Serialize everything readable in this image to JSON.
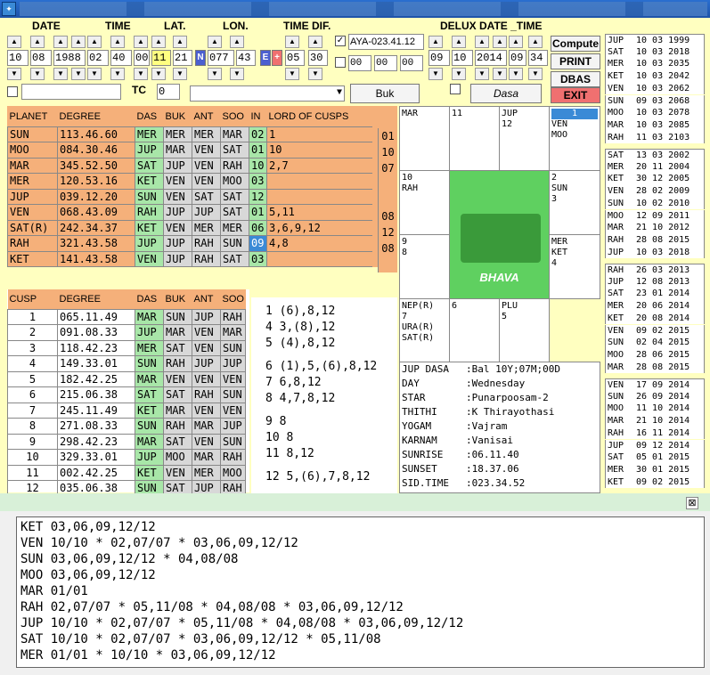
{
  "headers": {
    "date": "DATE",
    "time": "TIME",
    "lat": "LAT.",
    "lon": "LON.",
    "timedif": "TIME DIF.",
    "delux": "DELUX DATE _TIME"
  },
  "inputs": {
    "day": "10",
    "month": "08",
    "year": "1988",
    "hour": "02",
    "min": "40",
    "sec": "00",
    "lat_d": "11",
    "lat_m": "21",
    "lat_dir": "N",
    "lon_d": "077",
    "lon_m": "43",
    "lon_dir": "E",
    "tz_sign": "+",
    "tz_h": "05",
    "tz_m": "30",
    "ayanamsa": "AYA-023.41.12",
    "aya2": [
      "00",
      "00",
      "00"
    ],
    "dx_day": "09",
    "dx_month": "10",
    "dx_year": "2014",
    "dx_hour": "09",
    "dx_min": "34",
    "tc_label": "TC",
    "tc_value": "0"
  },
  "buttons": {
    "compute": "Compute",
    "print": "PRINT",
    "dbas": "DBAS",
    "exit": "EXIT",
    "buk": "Buk",
    "dasa": "Dasa"
  },
  "planet_table": {
    "headers": [
      "PLANET",
      "DEGREE",
      "DAS",
      "BUK",
      "ANT",
      "SOO",
      "IN",
      "LORD OF CUSPS"
    ],
    "rows": [
      [
        "SUN",
        "113.46.60",
        "MER",
        "MER",
        "MER",
        "MAR",
        "02",
        "1"
      ],
      [
        "MOO",
        "084.30.46",
        "JUP",
        "MAR",
        "VEN",
        "SAT",
        "01",
        "10"
      ],
      [
        "MAR",
        "345.52.50",
        "SAT",
        "JUP",
        "VEN",
        "RAH",
        "10",
        "2,7"
      ],
      [
        "MER",
        "120.53.16",
        "KET",
        "VEN",
        "VEN",
        "MOO",
        "03",
        ""
      ],
      [
        "JUP",
        "039.12.20",
        "SUN",
        "VEN",
        "SAT",
        "SAT",
        "12",
        ""
      ],
      [
        "VEN",
        "068.43.09",
        "RAH",
        "JUP",
        "JUP",
        "SAT",
        "01",
        "5,11"
      ],
      [
        "SAT(R)",
        "242.34.37",
        "KET",
        "VEN",
        "MER",
        "MER",
        "06",
        "3,6,9,12"
      ],
      [
        "RAH",
        "321.43.58",
        "JUP",
        "JUP",
        "RAH",
        "SUN",
        "09",
        "4,8"
      ],
      [
        "KET",
        "141.43.58",
        "VEN",
        "JUP",
        "RAH",
        "SAT",
        "03",
        ""
      ]
    ],
    "side": [
      "01",
      "10",
      "07",
      "",
      "",
      "08",
      "12",
      "08",
      ""
    ]
  },
  "cusp_table": {
    "headers": [
      "CUSP",
      "DEGREE",
      "DAS",
      "BUK",
      "ANT",
      "SOO"
    ],
    "rows": [
      [
        "1",
        "065.11.49",
        "MAR",
        "SUN",
        "JUP",
        "RAH"
      ],
      [
        "2",
        "091.08.33",
        "JUP",
        "MAR",
        "VEN",
        "MAR"
      ],
      [
        "3",
        "118.42.23",
        "MER",
        "SAT",
        "VEN",
        "SUN"
      ],
      [
        "4",
        "149.33.01",
        "SUN",
        "RAH",
        "JUP",
        "JUP"
      ],
      [
        "5",
        "182.42.25",
        "MAR",
        "VEN",
        "VEN",
        "VEN"
      ],
      [
        "6",
        "215.06.38",
        "SAT",
        "SAT",
        "RAH",
        "SUN"
      ],
      [
        "7",
        "245.11.49",
        "KET",
        "MAR",
        "VEN",
        "VEN"
      ],
      [
        "8",
        "271.08.33",
        "SUN",
        "RAH",
        "MAR",
        "JUP"
      ],
      [
        "9",
        "298.42.23",
        "MAR",
        "SAT",
        "VEN",
        "SUN"
      ],
      [
        "10",
        "329.33.01",
        "JUP",
        "MOO",
        "MAR",
        "RAH"
      ],
      [
        "11",
        "002.42.25",
        "KET",
        "VEN",
        "MER",
        "MOO"
      ],
      [
        "12",
        "035.06.38",
        "SUN",
        "SAT",
        "JUP",
        "RAH"
      ]
    ]
  },
  "significators": [
    [
      "1  (6),8,12",
      "4  3,(8),12",
      "5  (4),8,12"
    ],
    [
      "6  (1),5,(6),8,12",
      "7  6,8,12",
      "8  4,7,8,12"
    ],
    [
      "9  8",
      "10  8",
      "11  8,12"
    ],
    [
      "12  5,(6),7,8,12"
    ]
  ],
  "chart": {
    "c1": [
      "MAR"
    ],
    "c2": [
      "11"
    ],
    "c3": [
      "JUP",
      "12"
    ],
    "c4": [
      "1",
      "VEN",
      "MOO"
    ],
    "c5": [
      "10",
      "RAH"
    ],
    "c6": [
      "2",
      "SUN",
      "3"
    ],
    "c7": [
      "9",
      "8"
    ],
    "c8": [
      "MER",
      "KET",
      "4"
    ],
    "c9": [
      "NEP(R)",
      "7",
      "URA(R)",
      "SAT(R)"
    ],
    "c10": [
      "6"
    ],
    "c11": [
      "PLU",
      "5"
    ],
    "center": "BHAVA"
  },
  "info": [
    [
      "JUP DASA ",
      ":Bal 10Y;07M;00D"
    ],
    [
      "DAY",
      ":Wednesday"
    ],
    [
      "STAR",
      ":Punarpoosam-2"
    ],
    [
      "THITHI",
      ":K Thirayothasi"
    ],
    [
      "YOGAM",
      ":Vajram"
    ],
    [
      "KARNAM",
      ":Vanisai"
    ],
    [
      "SUNRISE",
      ":06.11.40"
    ],
    [
      "SUNSET",
      ":18.37.06"
    ],
    [
      "SID.TIME",
      ":023.34.52"
    ]
  ],
  "dasa_list": [
    [
      "JUP",
      "10 03 1999"
    ],
    [
      "SAT",
      "10 03 2018"
    ],
    [
      "MER",
      "10 03 2035"
    ],
    [
      "KET",
      "10 03 2042"
    ],
    [
      "VEN",
      "10 03 2062"
    ],
    [
      "SUN",
      "09 03 2068"
    ],
    [
      "MOO",
      "10 03 2078"
    ],
    [
      "MAR",
      "10 03 2085"
    ],
    [
      "RAH",
      "11 03 2103"
    ],
    [
      "SAT",
      "13 03 2002"
    ],
    [
      "MER",
      "20 11 2004"
    ],
    [
      "KET",
      "30 12 2005"
    ],
    [
      "VEN",
      "28 02 2009"
    ],
    [
      "SUN",
      "10 02 2010"
    ],
    [
      "MOO",
      "12 09 2011"
    ],
    [
      "MAR",
      "21 10 2012"
    ],
    [
      "RAH",
      "28 08 2015"
    ],
    [
      "JUP",
      "10 03 2018"
    ],
    [
      "RAH",
      "26 03 2013"
    ],
    [
      "JUP",
      "12 08 2013"
    ],
    [
      "SAT",
      "23 01 2014"
    ],
    [
      "MER",
      "20 06 2014"
    ],
    [
      "KET",
      "20 08 2014"
    ],
    [
      "VEN",
      "09 02 2015"
    ],
    [
      "SUN",
      "02 04 2015"
    ],
    [
      "MOO",
      "28 06 2015"
    ],
    [
      "MAR",
      "28 08 2015"
    ],
    [
      "VEN",
      "17 09 2014"
    ],
    [
      "SUN",
      "26 09 2014"
    ],
    [
      "MOO",
      "11 10 2014"
    ],
    [
      "MAR",
      "21 10 2014"
    ],
    [
      "RAH",
      "16 11 2014"
    ],
    [
      "JUP",
      "09 12 2014"
    ],
    [
      "SAT",
      "05 01 2015"
    ],
    [
      "MER",
      "30 01 2015"
    ],
    [
      "KET",
      "09 02 2015"
    ]
  ],
  "bottom_lines": [
    "KET 03,06,09,12/12",
    "VEN 10/10 * 02,07/07 * 03,06,09,12/12",
    "SUN 03,06,09,12/12 * 04,08/08",
    "MOO 03,06,09,12/12",
    "MAR 01/01",
    "RAH 02,07/07 * 05,11/08 * 04,08/08 * 03,06,09,12/12",
    "JUP 10/10 * 02,07/07 * 05,11/08 * 04,08/08 * 03,06,09,12/12",
    "SAT 10/10 * 02,07/07 * 03,06,09,12/12 * 05,11/08",
    "MER 01/01 * 10/10 * 03,06,09,12/12"
  ],
  "close_glyph": "⊠"
}
